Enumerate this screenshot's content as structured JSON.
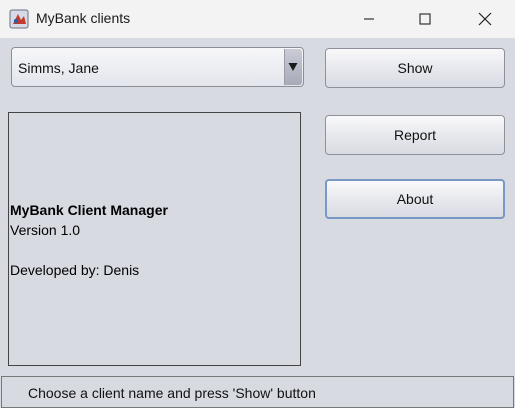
{
  "window": {
    "title": "MyBank clients"
  },
  "client_select": {
    "selected": "Simms, Jane"
  },
  "buttons": {
    "show": "Show",
    "report": "Report",
    "about": "About"
  },
  "info_panel": {
    "title": "MyBank Client Manager",
    "version": "Version 1.0",
    "developer": "Developed by: Denis"
  },
  "status": {
    "text": "Choose a client name and press 'Show' button"
  },
  "colors": {
    "focus_border": "#7a98c4",
    "window_bg": "#d8dae2"
  }
}
